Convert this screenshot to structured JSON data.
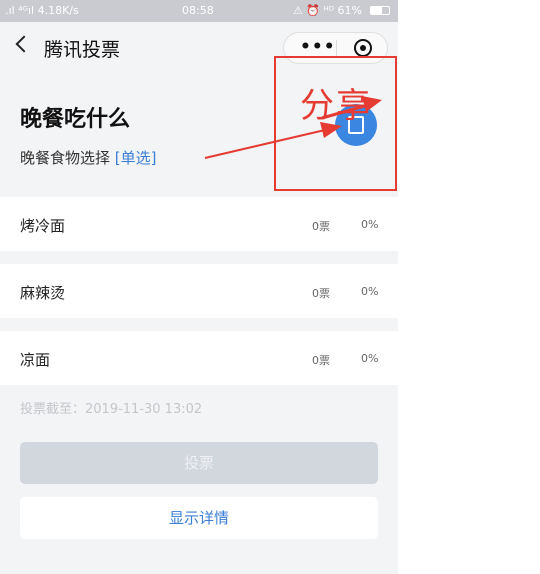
{
  "status_bar": {
    "left": " .ıl ⁴ᴳıl 4.18K/s",
    "time": "08:58",
    "right": "⚠ ⏰ ᴴᴰ 61%",
    "battery_level": 0.61
  },
  "nav": {
    "title": "腾讯投票",
    "more_glyph": "•••"
  },
  "poll": {
    "title": "晚餐吃什么",
    "subtitle": "晚餐食物选择",
    "type": "[单选]"
  },
  "annotation": {
    "label": "分享",
    "color": "#e53b32"
  },
  "options": [
    {
      "label": "烤冷面",
      "votes": "0票",
      "percent": "0%"
    },
    {
      "label": "麻辣烫",
      "votes": "0票",
      "percent": "0%"
    },
    {
      "label": "凉面",
      "votes": "0票",
      "percent": "0%"
    }
  ],
  "deadline": "投票截至：2019-11-30 13:02",
  "buttons": {
    "vote": "投票",
    "details": "显示详情"
  },
  "colors": {
    "accent": "#3b7ed6",
    "fab": "#3a86e0",
    "disabled_button": "#d2d6dd"
  }
}
